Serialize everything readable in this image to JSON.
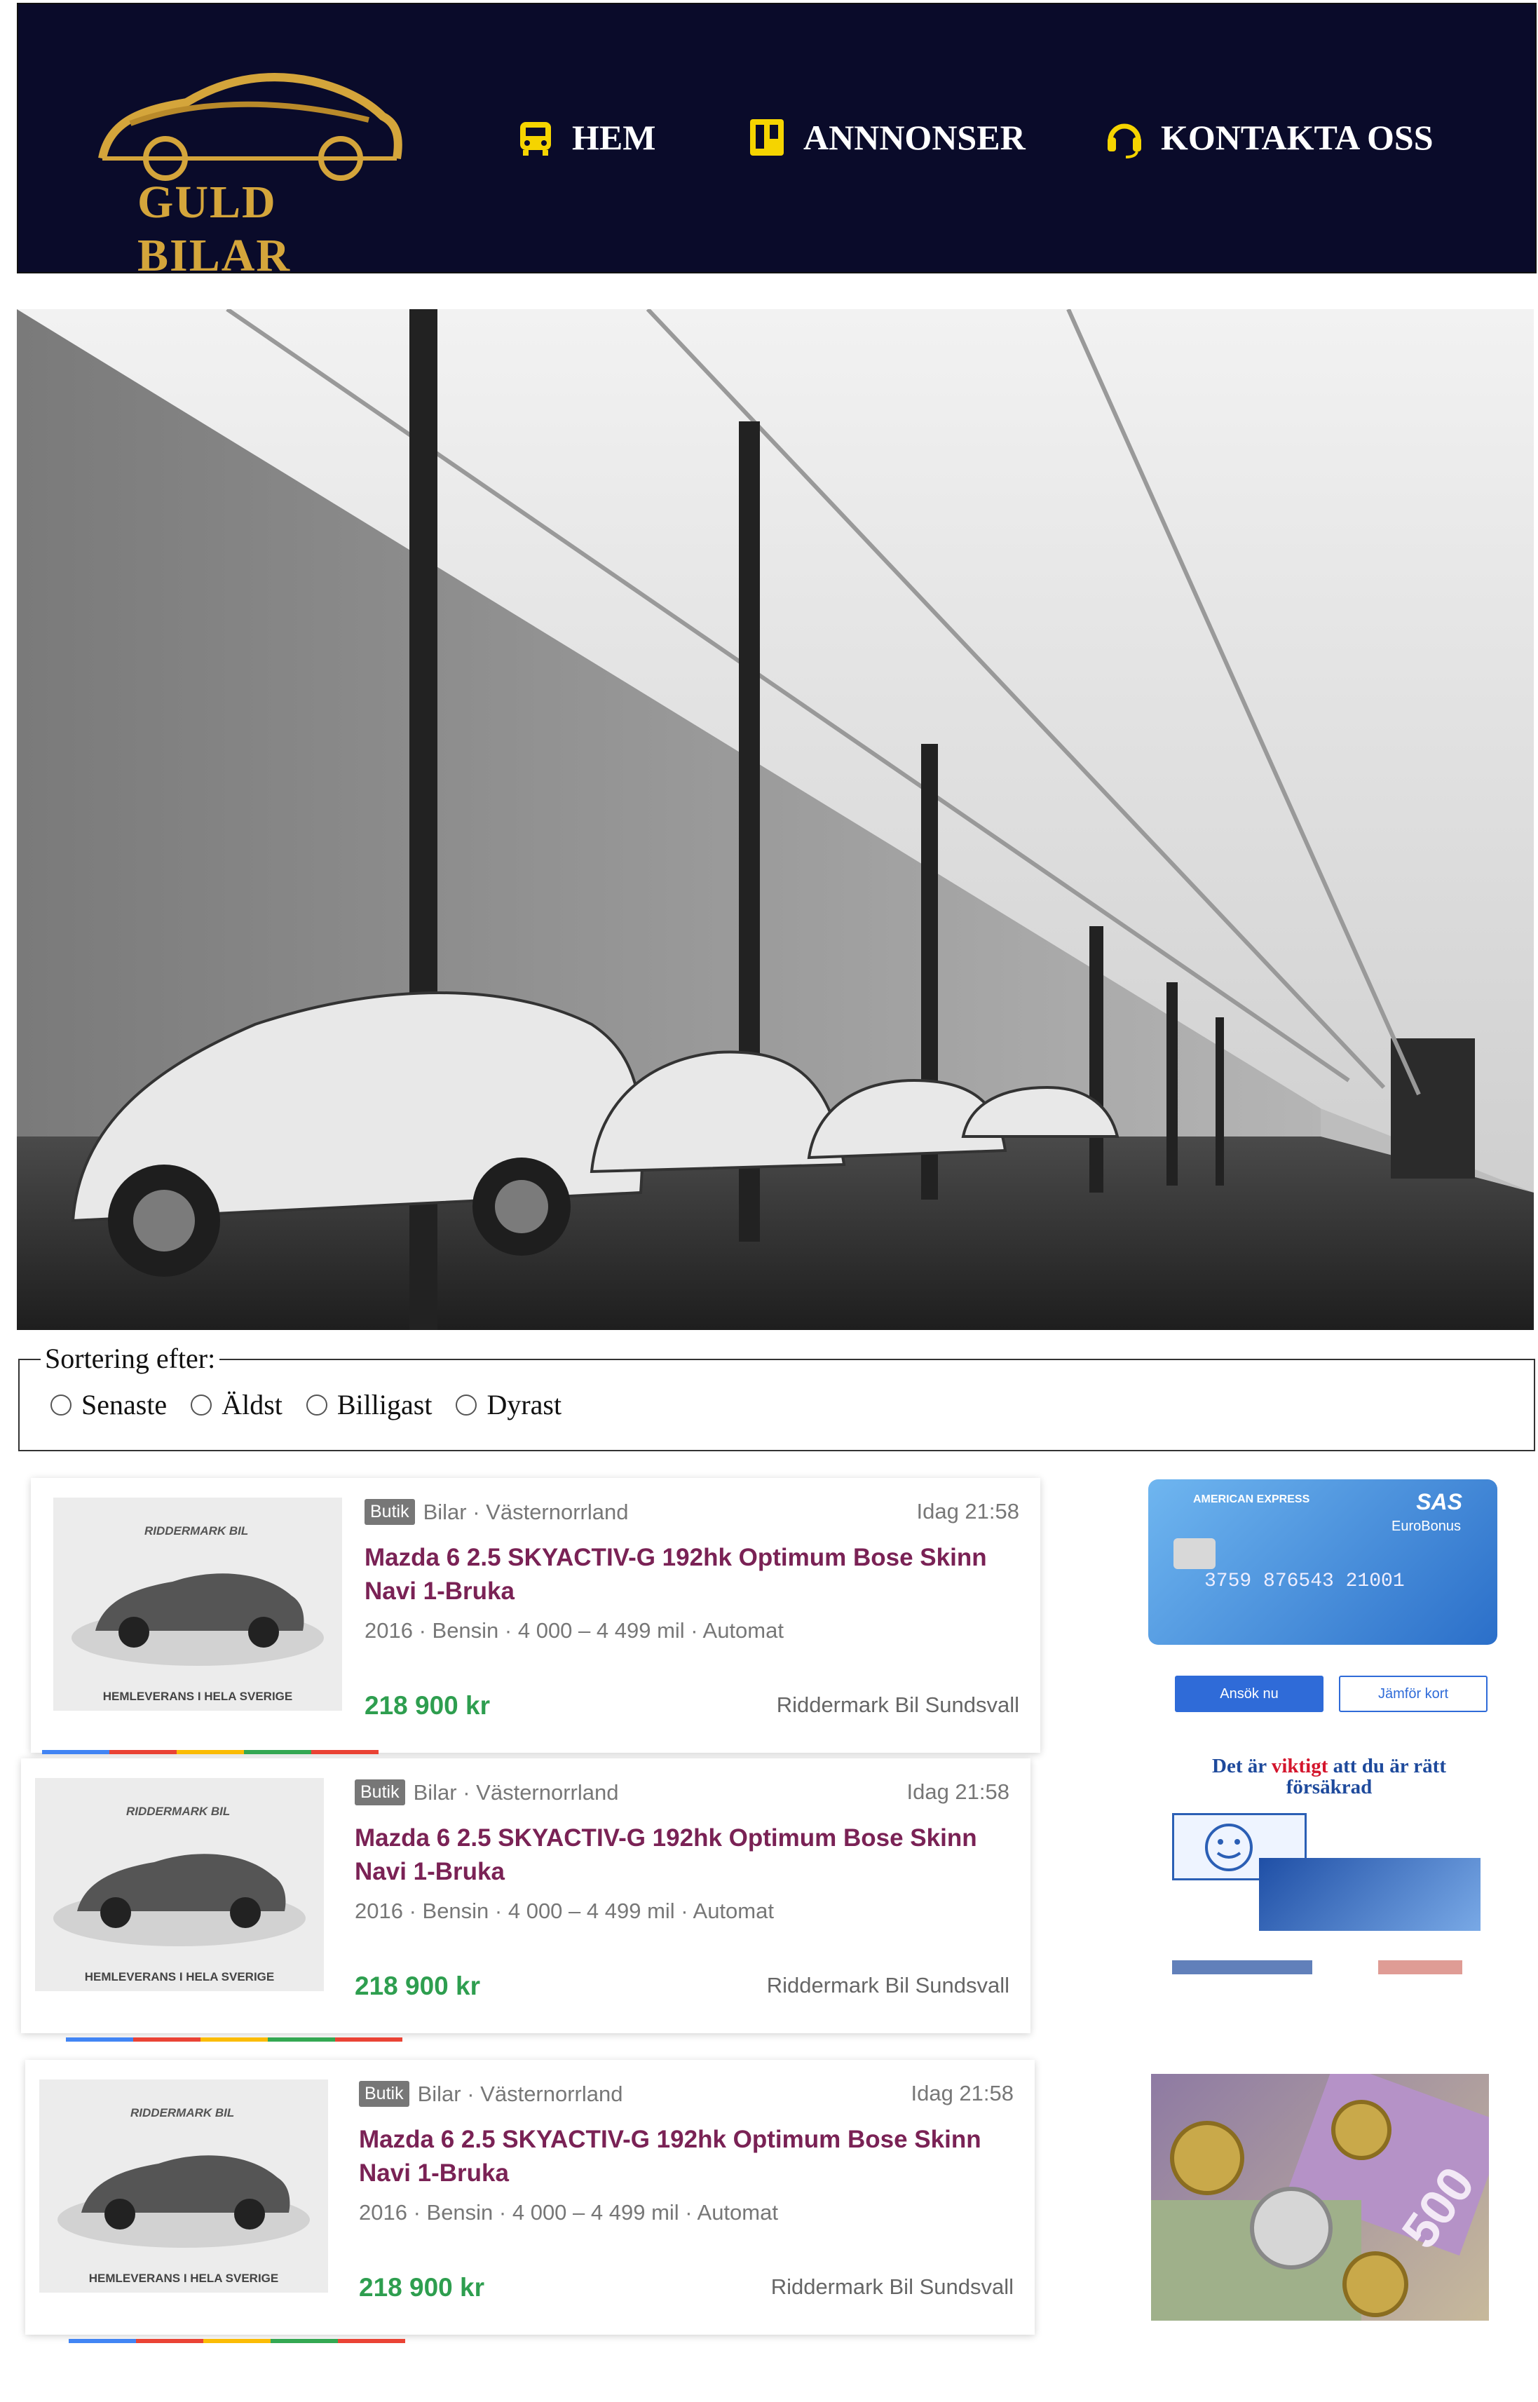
{
  "brand": {
    "name": "GULD BILAR"
  },
  "nav": [
    {
      "label": "HEM",
      "icon": "car-icon"
    },
    {
      "label": "ANNNONSER",
      "icon": "trello-board-icon"
    },
    {
      "label": "KONTAKTA OSS",
      "icon": "headset-icon"
    }
  ],
  "sort": {
    "legend": "Sortering efter:",
    "options": [
      "Senaste",
      "Äldst",
      "Billigast",
      "Dyrast"
    ]
  },
  "listings": [
    {
      "badge": "Butik",
      "category": "Bilar · Västernorrland",
      "date": "Idag 21:58",
      "title": "Mazda 6 2.5 SKYACTIV-G 192hk Optimum Bose Skinn Navi 1-Bruka",
      "specs": "2016 · Bensin · 4 000 – 4 499 mil · Automat",
      "price": "218 900 kr",
      "seller": "Riddermark Bil Sundsvall",
      "thumb_brand": "RIDDERMARK BIL",
      "thumb_footer": "HEMLEVERANS I HELA SVERIGE"
    },
    {
      "badge": "Butik",
      "category": "Bilar · Västernorrland",
      "date": "Idag 21:58",
      "title": "Mazda 6 2.5 SKYACTIV-G 192hk Optimum Bose Skinn Navi 1-Bruka",
      "specs": "2016 · Bensin · 4 000 – 4 499 mil · Automat",
      "price": "218 900 kr",
      "seller": "Riddermark Bil Sundsvall",
      "thumb_brand": "RIDDERMARK BIL",
      "thumb_footer": "HEMLEVERANS I HELA SVERIGE"
    },
    {
      "badge": "Butik",
      "category": "Bilar · Västernorrland",
      "date": "Idag 21:58",
      "title": "Mazda 6 2.5 SKYACTIV-G 192hk Optimum Bose Skinn Navi 1-Bruka",
      "specs": "2016 · Bensin · 4 000 – 4 499 mil · Automat",
      "price": "218 900 kr",
      "seller": "Riddermark Bil Sundsvall",
      "thumb_brand": "RIDDERMARK BIL",
      "thumb_footer": "HEMLEVERANS I HELA SVERIGE"
    }
  ],
  "ads": {
    "card": {
      "issuer": "AMERICAN EXPRESS",
      "airline": "SAS",
      "program": "EuroBonus",
      "number": "3759 876543 21001",
      "apply_label": "Ansök nu",
      "compare_label": "Jämför kort"
    },
    "insurance": {
      "headline": "Det är viktigt att du är rätt försäkrad",
      "emphasis": "viktigt"
    },
    "money": {
      "banknote": "500"
    }
  },
  "colors": {
    "header_bg": "#0a0b2a",
    "gold": "#d4a53b",
    "title": "#7a2255",
    "price": "#2e9e4f",
    "apply_button": "#2f6bd8"
  }
}
